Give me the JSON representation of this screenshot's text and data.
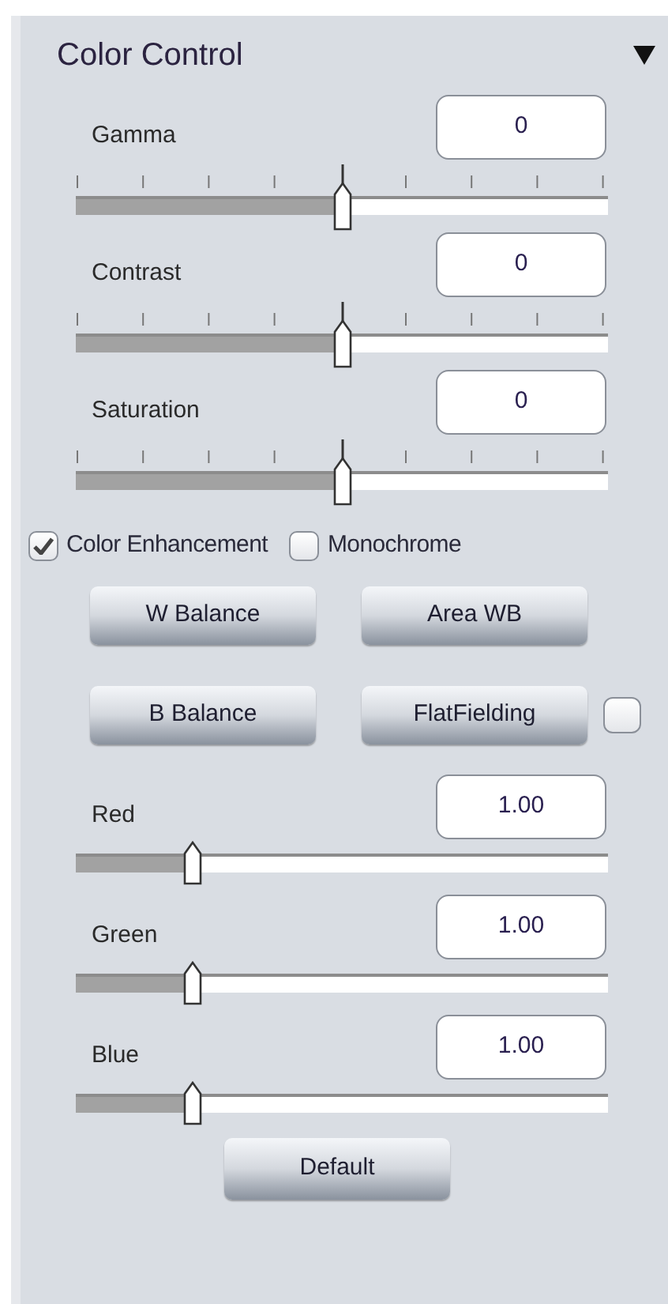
{
  "panel": {
    "title": "Color Control",
    "expanded": true
  },
  "adjustments": [
    {
      "label": "Gamma",
      "value": "0",
      "level": 0.5,
      "ticks": true
    },
    {
      "label": "Contrast",
      "value": "0",
      "level": 0.5,
      "ticks": true
    },
    {
      "label": "Saturation",
      "value": "0",
      "level": 0.5,
      "ticks": true
    }
  ],
  "options": [
    {
      "label": "Color Enhancement",
      "checked": true
    },
    {
      "label": "Monochrome",
      "checked": false
    }
  ],
  "buttons": [
    {
      "label": "W Balance"
    },
    {
      "label": "Area WB"
    },
    {
      "label": "B Balance"
    },
    {
      "label": "FlatFielding",
      "checked": false
    }
  ],
  "channels": [
    {
      "label": "Red",
      "value": "1.00",
      "level": 0.22,
      "ticks": false
    },
    {
      "label": "Green",
      "value": "1.00",
      "level": 0.22,
      "ticks": false
    },
    {
      "label": "Blue",
      "value": "1.00",
      "level": 0.22,
      "ticks": false
    }
  ],
  "default_button": "Default"
}
